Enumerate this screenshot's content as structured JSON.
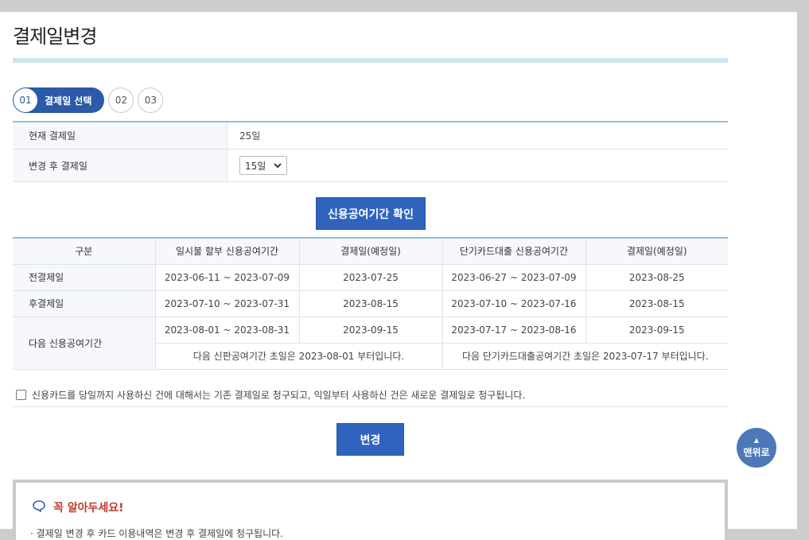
{
  "page": {
    "title": "결제일변경"
  },
  "steps": [
    {
      "num": "01",
      "label": "결제일 선택"
    },
    {
      "num": "02"
    },
    {
      "num": "03"
    }
  ],
  "info": {
    "current_label": "현재 결제일",
    "current_value": "25일",
    "after_label": "변경 후 결제일",
    "after_select_value": "15일"
  },
  "buttons": {
    "check": "신용공여기간 확인",
    "change": "변경",
    "top": "맨위로"
  },
  "table": {
    "headers": [
      "구분",
      "일시불 할부 신용공여기간",
      "결제일(예정일)",
      "단기카드대출 신용공여기간",
      "결제일(예정일)"
    ],
    "rows": [
      [
        "전결제일",
        "2023-06-11 ~ 2023-07-09",
        "2023-07-25",
        "2023-06-27 ~ 2023-07-09",
        "2023-08-25"
      ],
      [
        "후결제일",
        "2023-07-10 ~ 2023-07-31",
        "2023-08-15",
        "2023-07-10 ~ 2023-07-16",
        "2023-08-15"
      ],
      [
        "다음 신용공여기간",
        "2023-08-01 ~ 2023-08-31",
        "2023-09-15",
        "2023-07-17 ~ 2023-08-16",
        "2023-09-15"
      ]
    ],
    "note_left": "다음 신판공여기간 초일은 2023-08-01 부터입니다.",
    "note_right": "다음 단기카드대출공여기간 초일은 2023-07-17 부터입니다."
  },
  "agree_text": "신용카드를 당일까지 사용하신 건에 대해서는 기존 결제일로 청구되고, 익일부터 사용하신 건은 새로운 결제일로 청구됩니다.",
  "notice": {
    "title": "꼭 알아두세요!",
    "items": [
      "결제일 변경 후 카드 이용내역은 변경 후 결제일에 청구됩니다."
    ]
  },
  "colors": {
    "primary": "#2f63bd",
    "accent_line": "#8cc0dc",
    "notice_title": "#c0392b"
  }
}
